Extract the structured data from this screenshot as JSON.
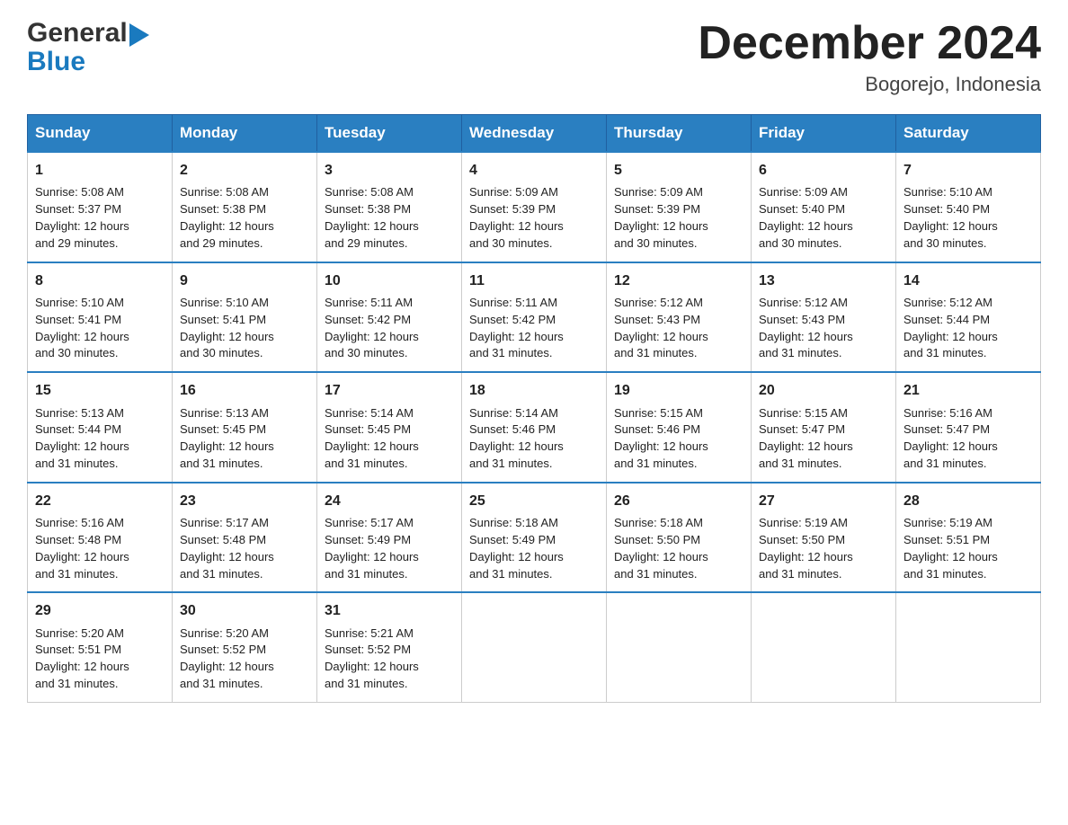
{
  "header": {
    "logo": {
      "line1": "General",
      "arrow_char": "▶",
      "line2": "Blue"
    },
    "title": "December 2024",
    "location": "Bogorejo, Indonesia"
  },
  "days_of_week": [
    "Sunday",
    "Monday",
    "Tuesday",
    "Wednesday",
    "Thursday",
    "Friday",
    "Saturday"
  ],
  "weeks": [
    [
      {
        "day": "1",
        "sunrise": "5:08 AM",
        "sunset": "5:37 PM",
        "daylight": "12 hours and 29 minutes."
      },
      {
        "day": "2",
        "sunrise": "5:08 AM",
        "sunset": "5:38 PM",
        "daylight": "12 hours and 29 minutes."
      },
      {
        "day": "3",
        "sunrise": "5:08 AM",
        "sunset": "5:38 PM",
        "daylight": "12 hours and 29 minutes."
      },
      {
        "day": "4",
        "sunrise": "5:09 AM",
        "sunset": "5:39 PM",
        "daylight": "12 hours and 30 minutes."
      },
      {
        "day": "5",
        "sunrise": "5:09 AM",
        "sunset": "5:39 PM",
        "daylight": "12 hours and 30 minutes."
      },
      {
        "day": "6",
        "sunrise": "5:09 AM",
        "sunset": "5:40 PM",
        "daylight": "12 hours and 30 minutes."
      },
      {
        "day": "7",
        "sunrise": "5:10 AM",
        "sunset": "5:40 PM",
        "daylight": "12 hours and 30 minutes."
      }
    ],
    [
      {
        "day": "8",
        "sunrise": "5:10 AM",
        "sunset": "5:41 PM",
        "daylight": "12 hours and 30 minutes."
      },
      {
        "day": "9",
        "sunrise": "5:10 AM",
        "sunset": "5:41 PM",
        "daylight": "12 hours and 30 minutes."
      },
      {
        "day": "10",
        "sunrise": "5:11 AM",
        "sunset": "5:42 PM",
        "daylight": "12 hours and 30 minutes."
      },
      {
        "day": "11",
        "sunrise": "5:11 AM",
        "sunset": "5:42 PM",
        "daylight": "12 hours and 31 minutes."
      },
      {
        "day": "12",
        "sunrise": "5:12 AM",
        "sunset": "5:43 PM",
        "daylight": "12 hours and 31 minutes."
      },
      {
        "day": "13",
        "sunrise": "5:12 AM",
        "sunset": "5:43 PM",
        "daylight": "12 hours and 31 minutes."
      },
      {
        "day": "14",
        "sunrise": "5:12 AM",
        "sunset": "5:44 PM",
        "daylight": "12 hours and 31 minutes."
      }
    ],
    [
      {
        "day": "15",
        "sunrise": "5:13 AM",
        "sunset": "5:44 PM",
        "daylight": "12 hours and 31 minutes."
      },
      {
        "day": "16",
        "sunrise": "5:13 AM",
        "sunset": "5:45 PM",
        "daylight": "12 hours and 31 minutes."
      },
      {
        "day": "17",
        "sunrise": "5:14 AM",
        "sunset": "5:45 PM",
        "daylight": "12 hours and 31 minutes."
      },
      {
        "day": "18",
        "sunrise": "5:14 AM",
        "sunset": "5:46 PM",
        "daylight": "12 hours and 31 minutes."
      },
      {
        "day": "19",
        "sunrise": "5:15 AM",
        "sunset": "5:46 PM",
        "daylight": "12 hours and 31 minutes."
      },
      {
        "day": "20",
        "sunrise": "5:15 AM",
        "sunset": "5:47 PM",
        "daylight": "12 hours and 31 minutes."
      },
      {
        "day": "21",
        "sunrise": "5:16 AM",
        "sunset": "5:47 PM",
        "daylight": "12 hours and 31 minutes."
      }
    ],
    [
      {
        "day": "22",
        "sunrise": "5:16 AM",
        "sunset": "5:48 PM",
        "daylight": "12 hours and 31 minutes."
      },
      {
        "day": "23",
        "sunrise": "5:17 AM",
        "sunset": "5:48 PM",
        "daylight": "12 hours and 31 minutes."
      },
      {
        "day": "24",
        "sunrise": "5:17 AM",
        "sunset": "5:49 PM",
        "daylight": "12 hours and 31 minutes."
      },
      {
        "day": "25",
        "sunrise": "5:18 AM",
        "sunset": "5:49 PM",
        "daylight": "12 hours and 31 minutes."
      },
      {
        "day": "26",
        "sunrise": "5:18 AM",
        "sunset": "5:50 PM",
        "daylight": "12 hours and 31 minutes."
      },
      {
        "day": "27",
        "sunrise": "5:19 AM",
        "sunset": "5:50 PM",
        "daylight": "12 hours and 31 minutes."
      },
      {
        "day": "28",
        "sunrise": "5:19 AM",
        "sunset": "5:51 PM",
        "daylight": "12 hours and 31 minutes."
      }
    ],
    [
      {
        "day": "29",
        "sunrise": "5:20 AM",
        "sunset": "5:51 PM",
        "daylight": "12 hours and 31 minutes."
      },
      {
        "day": "30",
        "sunrise": "5:20 AM",
        "sunset": "5:52 PM",
        "daylight": "12 hours and 31 minutes."
      },
      {
        "day": "31",
        "sunrise": "5:21 AM",
        "sunset": "5:52 PM",
        "daylight": "12 hours and 31 minutes."
      },
      null,
      null,
      null,
      null
    ]
  ],
  "labels": {
    "sunrise": "Sunrise:",
    "sunset": "Sunset:",
    "daylight": "Daylight:"
  }
}
